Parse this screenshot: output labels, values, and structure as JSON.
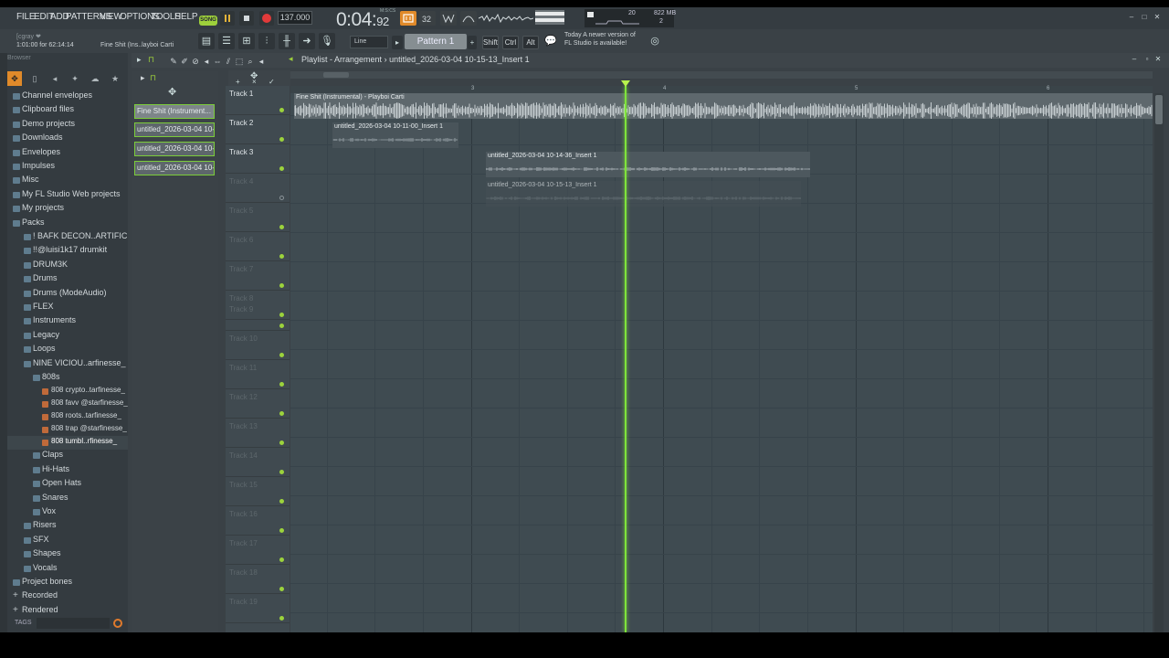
{
  "menu": [
    "FILE",
    "EDIT",
    "ADD",
    "PATTERNS",
    "VIEW",
    "OPTIONS",
    "TOOLS",
    "HELP"
  ],
  "transport": {
    "song_mode": "SONG",
    "tempo": "137.000",
    "time_main": "0:04:",
    "time_sub": "92",
    "time_label": "M:S:CS"
  },
  "cpu": {
    "value": "20",
    "memory": "822 MB",
    "voices": "2"
  },
  "hint": {
    "user": "[cgray ❤",
    "position": "1:01:00 for 62:14:14",
    "clip_name": "Fine Shit (Ins..layboi Carti"
  },
  "snap": "Line",
  "pattern": "Pattern 1",
  "modifier_keys": [
    "Shift",
    "Ctrl",
    "Alt"
  ],
  "news": {
    "line1": "Today  A newer version of",
    "line2": "FL Studio is available!"
  },
  "browser": {
    "title": "Browser",
    "items": [
      {
        "label": "Channel envelopes",
        "indent": 0,
        "kind": "folder"
      },
      {
        "label": "Clipboard files",
        "indent": 0,
        "kind": "folder"
      },
      {
        "label": "Demo projects",
        "indent": 0,
        "kind": "folder"
      },
      {
        "label": "Downloads",
        "indent": 0,
        "kind": "folder"
      },
      {
        "label": "Envelopes",
        "indent": 0,
        "kind": "folder"
      },
      {
        "label": "Impulses",
        "indent": 0,
        "kind": "folder"
      },
      {
        "label": "Misc",
        "indent": 0,
        "kind": "folder"
      },
      {
        "label": "My FL Studio Web projects",
        "indent": 0,
        "kind": "folder"
      },
      {
        "label": "My projects",
        "indent": 0,
        "kind": "folder"
      },
      {
        "label": "Packs",
        "indent": 0,
        "kind": "folder"
      },
      {
        "label": "! BAFK DECON..ARTIFICIAL",
        "indent": 1,
        "kind": "folder"
      },
      {
        "label": "!!@luisi1k17 drumkit",
        "indent": 1,
        "kind": "folder"
      },
      {
        "label": "DRUM3K",
        "indent": 1,
        "kind": "folder"
      },
      {
        "label": "Drums",
        "indent": 1,
        "kind": "folder"
      },
      {
        "label": "Drums (ModeAudio)",
        "indent": 1,
        "kind": "folder"
      },
      {
        "label": "FLEX",
        "indent": 1,
        "kind": "folder"
      },
      {
        "label": "Instruments",
        "indent": 1,
        "kind": "folder"
      },
      {
        "label": "Legacy",
        "indent": 1,
        "kind": "folder"
      },
      {
        "label": "Loops",
        "indent": 1,
        "kind": "folder"
      },
      {
        "label": "NINE VICIOU..arfinesse_",
        "indent": 1,
        "kind": "folder"
      },
      {
        "label": "808s",
        "indent": 2,
        "kind": "folder"
      },
      {
        "label": "808 crypto..tarfinesse_",
        "indent": 3,
        "kind": "file"
      },
      {
        "label": "808 favv @starfinesse_",
        "indent": 3,
        "kind": "file"
      },
      {
        "label": "808 roots..tarfinesse_",
        "indent": 3,
        "kind": "file"
      },
      {
        "label": "808 trap @starfinesse_",
        "indent": 3,
        "kind": "file"
      },
      {
        "label": "808 tumbl..rfinesse_",
        "indent": 3,
        "kind": "file"
      },
      {
        "label": "Claps",
        "indent": 2,
        "kind": "folder"
      },
      {
        "label": "Hi-Hats",
        "indent": 2,
        "kind": "folder"
      },
      {
        "label": "Open Hats",
        "indent": 2,
        "kind": "folder"
      },
      {
        "label": "Snares",
        "indent": 2,
        "kind": "folder"
      },
      {
        "label": "Vox",
        "indent": 2,
        "kind": "folder"
      },
      {
        "label": "Risers",
        "indent": 1,
        "kind": "folder"
      },
      {
        "label": "SFX",
        "indent": 1,
        "kind": "folder"
      },
      {
        "label": "Shapes",
        "indent": 1,
        "kind": "folder"
      },
      {
        "label": "Vocals",
        "indent": 1,
        "kind": "folder"
      },
      {
        "label": "Project bones",
        "indent": 0,
        "kind": "folder"
      },
      {
        "label": "Recorded",
        "indent": 0,
        "kind": "plus"
      },
      {
        "label": "Rendered",
        "indent": 0,
        "kind": "plus"
      }
    ],
    "tags_label": "TAGS"
  },
  "clip_sources": [
    "Fine Shit (Instrument...",
    "untitled_2026-03-04 10-...",
    "untitled_2026-03-04 10-...",
    "untitled_2026-03-04 10-..."
  ],
  "playlist": {
    "crumb": "Playlist - Arrangement",
    "crumb_sep": "›",
    "clip_name": "untitled_2026-03-04 10-15-13_Insert 1",
    "bar_numbers": [
      "3",
      "4",
      "5",
      "6"
    ],
    "tracks": [
      "Track 1",
      "Track 2",
      "Track 3",
      "Track 4",
      "Track 5",
      "Track 6",
      "Track 7",
      "Track 8",
      "Track 9",
      "Track 10",
      "Track 11",
      "Track 12",
      "Track 13",
      "Track 14",
      "Track 15",
      "Track 16",
      "Track 17",
      "Track 18",
      "Track 19"
    ],
    "clips": [
      {
        "title": "Fine Shit (Instrumental) - Playboi Carti",
        "track": 1
      },
      {
        "title": "untitled_2026-03-04 10-11-00_Insert 1",
        "track": 2
      },
      {
        "title": "untitled_2026-03-04 10-14-36_Insert 1",
        "track": 3
      },
      {
        "title": "untitled_2026-03-04 10-15-13_Insert 1",
        "track": 4
      }
    ]
  },
  "colors": {
    "accent": "#7fe43b",
    "song": "#9ed13b",
    "record": "#e23a3a",
    "orange": "#e08a2a"
  }
}
